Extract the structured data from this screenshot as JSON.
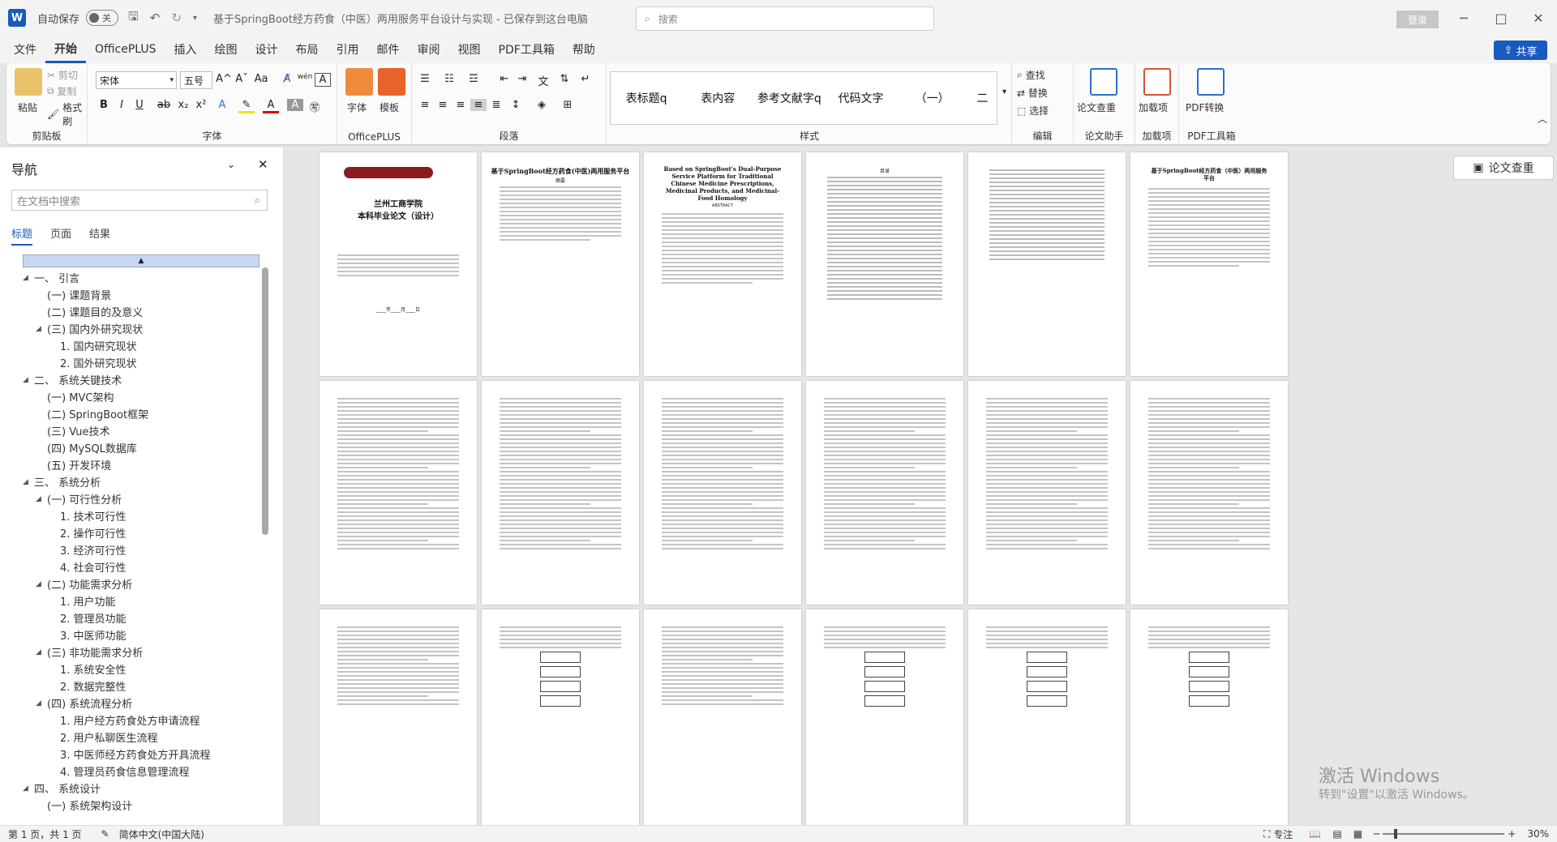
{
  "titlebar": {
    "app_icon": "W",
    "autosave_label": "自动保存",
    "autosave_state": "关",
    "doc_title": "基于SpringBoot经方药食（中医）两用服务平台设计与实现 - 已保存到这台电脑",
    "search_placeholder": "搜索",
    "login_label": "登录"
  },
  "menu": [
    "文件",
    "开始",
    "OfficePLUS",
    "插入",
    "绘图",
    "设计",
    "布局",
    "引用",
    "邮件",
    "审阅",
    "视图",
    "PDF工具箱",
    "帮助"
  ],
  "share_label": "共享",
  "ribbon": {
    "clipboard": {
      "label": "剪贴板",
      "paste": "粘贴",
      "cut": "剪切",
      "copy": "复制",
      "format_painter": "格式刷"
    },
    "font": {
      "label": "字体",
      "font_name": "宋体",
      "font_size": "五号",
      "bold": "B",
      "italic": "I",
      "underline": "U",
      "strike": "ab",
      "sub": "x₂",
      "sup": "x²",
      "font_color": "A",
      "change_case": "Aa",
      "grow": "A^",
      "shrink": "Aˇ",
      "wen": "wén",
      "border_char": "A"
    },
    "officeplus": {
      "label": "OfficePLUS",
      "font_btn": "字体",
      "template_btn": "模板"
    },
    "paragraph": {
      "label": "段落"
    },
    "styles": {
      "label": "样式",
      "items": [
        "表标题q",
        "表内容",
        "参考文献字q",
        "代码文字",
        "（一）",
        "二"
      ]
    },
    "editing": {
      "label": "编辑",
      "find": "查找",
      "replace": "替换",
      "select": "选择"
    },
    "paper_assist": {
      "label": "论文助手",
      "btn": "论文查重"
    },
    "addins": {
      "label": "加载项",
      "btn": "加载项"
    },
    "pdf": {
      "label": "PDF工具箱",
      "btn": "PDF转换"
    }
  },
  "nav": {
    "title": "导航",
    "search_placeholder": "在文档中搜索",
    "tabs": [
      "标题",
      "页面",
      "结果"
    ],
    "items": [
      {
        "text": "一、 引言",
        "level": 0,
        "tri": "◢"
      },
      {
        "text": "(一)  课题背景",
        "level": 1,
        "tri": ""
      },
      {
        "text": "(二)  课题目的及意义",
        "level": 1,
        "tri": ""
      },
      {
        "text": "(三)  国内外研究现状",
        "level": 1,
        "tri": "◢"
      },
      {
        "text": "1. 国内研究现状",
        "level": 2,
        "tri": ""
      },
      {
        "text": "2. 国外研究现状",
        "level": 2,
        "tri": ""
      },
      {
        "text": "二、 系统关键技术",
        "level": 0,
        "tri": "◢"
      },
      {
        "text": "(一)  MVC架构",
        "level": 1,
        "tri": ""
      },
      {
        "text": "(二)  SpringBoot框架",
        "level": 1,
        "tri": ""
      },
      {
        "text": "(三)  Vue技术",
        "level": 1,
        "tri": ""
      },
      {
        "text": "(四)  MySQL数据库",
        "level": 1,
        "tri": ""
      },
      {
        "text": "(五)  开发环境",
        "level": 1,
        "tri": ""
      },
      {
        "text": "三、 系统分析",
        "level": 0,
        "tri": "◢"
      },
      {
        "text": "(一)  可行性分析",
        "level": 1,
        "tri": "◢"
      },
      {
        "text": "1. 技术可行性",
        "level": 2,
        "tri": ""
      },
      {
        "text": "2. 操作可行性",
        "level": 2,
        "tri": ""
      },
      {
        "text": "3. 经济可行性",
        "level": 2,
        "tri": ""
      },
      {
        "text": "4. 社会可行性",
        "level": 2,
        "tri": ""
      },
      {
        "text": "(二)  功能需求分析",
        "level": 1,
        "tri": "◢"
      },
      {
        "text": "1. 用户功能",
        "level": 2,
        "tri": ""
      },
      {
        "text": "2. 管理员功能",
        "level": 2,
        "tri": ""
      },
      {
        "text": "3. 中医师功能",
        "level": 2,
        "tri": ""
      },
      {
        "text": "(三)  非功能需求分析",
        "level": 1,
        "tri": "◢"
      },
      {
        "text": "1. 系统安全性",
        "level": 2,
        "tri": ""
      },
      {
        "text": "2. 数据完整性",
        "level": 2,
        "tri": ""
      },
      {
        "text": "(四)  系统流程分析",
        "level": 1,
        "tri": "◢"
      },
      {
        "text": "1. 用户经方药食处方申请流程",
        "level": 2,
        "tri": ""
      },
      {
        "text": "2. 用户私聊医生流程",
        "level": 2,
        "tri": ""
      },
      {
        "text": "3. 中医师经方药食处方开具流程",
        "level": 2,
        "tri": ""
      },
      {
        "text": "4. 管理员药食信息管理流程",
        "level": 2,
        "tri": ""
      },
      {
        "text": "四、 系统设计",
        "level": 0,
        "tri": "◢"
      },
      {
        "text": "(一)  系统架构设计",
        "level": 1,
        "tri": ""
      }
    ]
  },
  "pages": {
    "cover": {
      "school": "兰州工商学院",
      "subtitle": "本科毕业论文（设计）",
      "date": "____年____月____日"
    },
    "cn_title": "基于SpringBoot经方药食(中医)两用服务平台",
    "en_title": "Based on SpringBoot's Dual-Purpose Service Platform for Traditional Chinese Medicine Prescriptions, Medicinal Products, and Medicinal-Food Homology",
    "abstract_label": "ABSTRACT",
    "cn_abstract": "摘要",
    "toc_label": "目录",
    "p6_title": "基于SpringBoot经方药食（中医）两用服务平台"
  },
  "floating_btn": "论文查重",
  "watermark": {
    "line1": "激活 Windows",
    "line2": "转到\"设置\"以激活 Windows。"
  },
  "status": {
    "page": "第 1 页，共 1 页",
    "lang": "简体中文(中国大陆)",
    "focus": "专注",
    "zoom": "30%"
  }
}
